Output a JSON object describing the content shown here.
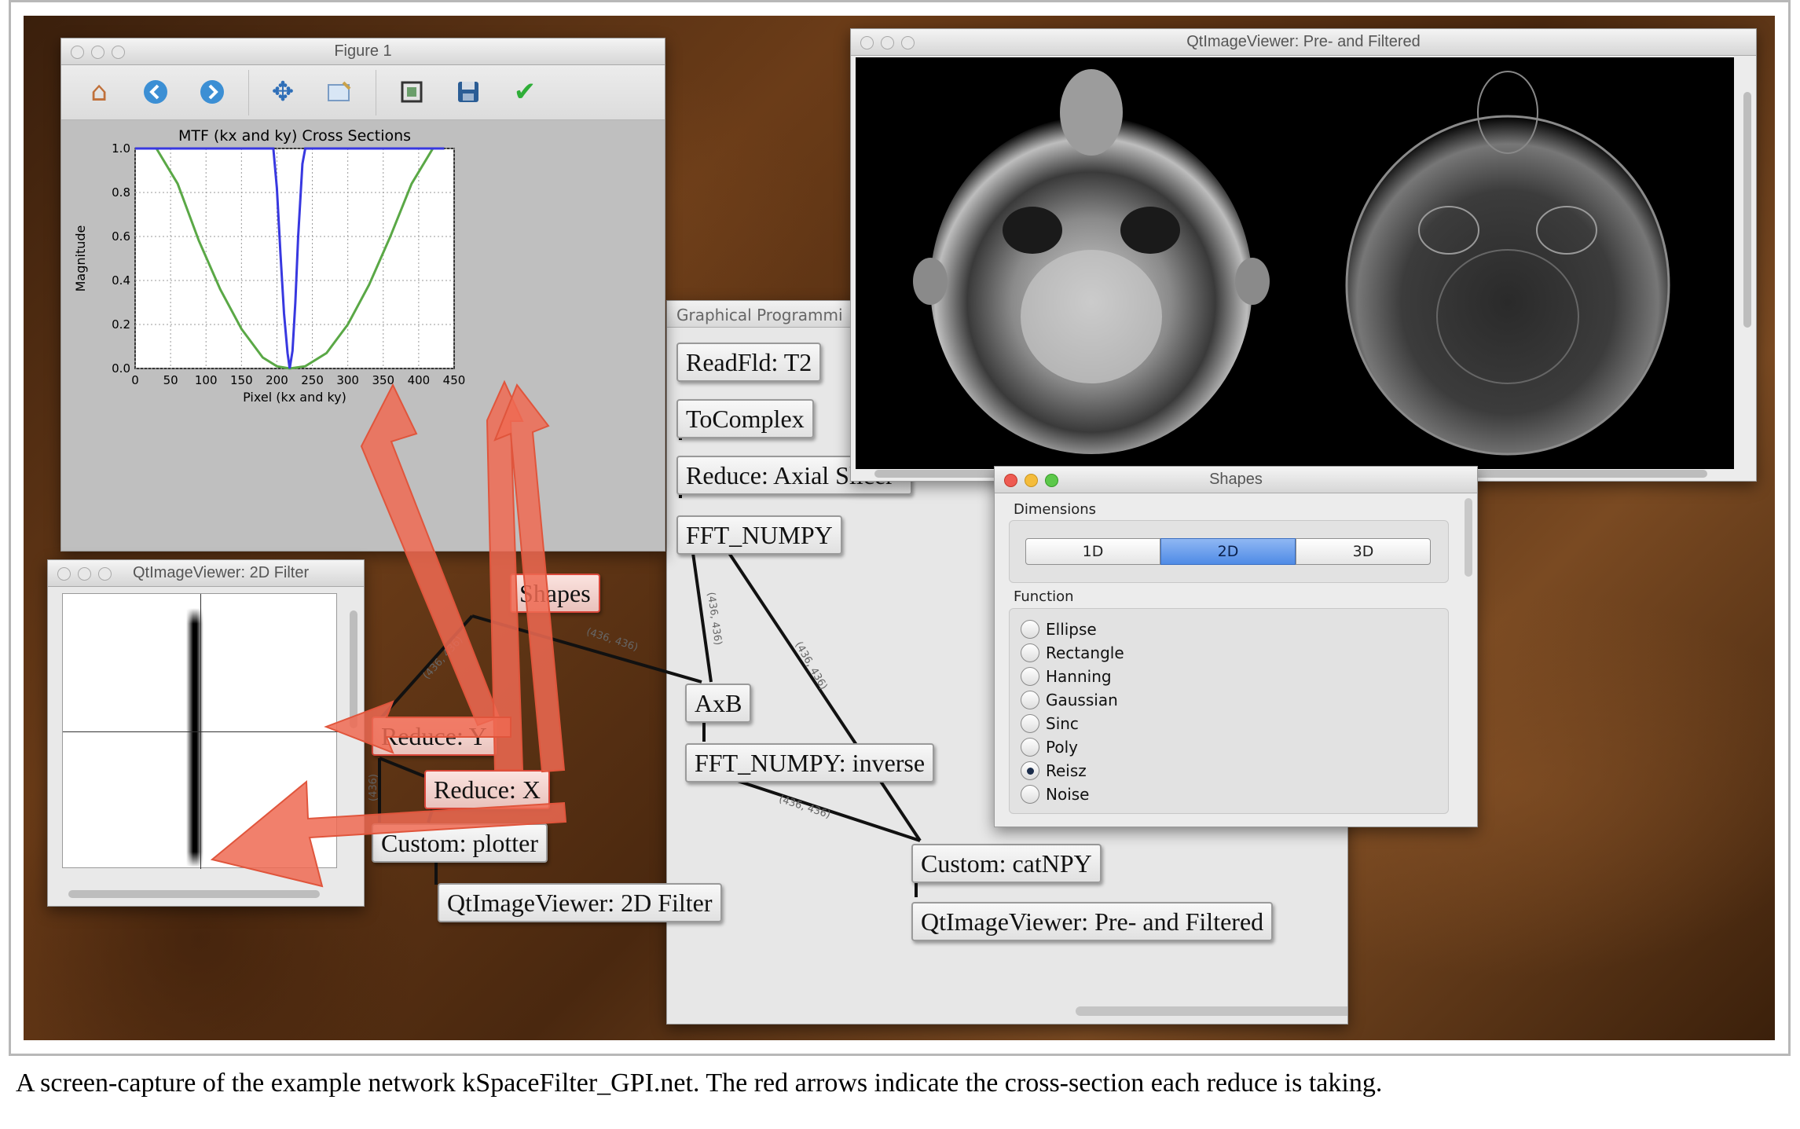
{
  "figure_window": {
    "title": "Figure 1",
    "toolbar": [
      "home-icon",
      "back-icon",
      "forward-icon",
      "pan-icon",
      "zoom-icon",
      "subplots-icon",
      "save-icon",
      "check-icon"
    ]
  },
  "filter_viewer": {
    "title": "QtImageViewer: 2D Filter"
  },
  "preview_viewer": {
    "title": "QtImageViewer: Pre- and Filtered"
  },
  "network_window": {
    "title": "Graphical Programmi"
  },
  "shapes_dialog": {
    "title": "Shapes",
    "dimensions_label": "Dimensions",
    "dimensions": [
      "1D",
      "2D",
      "3D"
    ],
    "selected_dimension": "2D",
    "function_label": "Function",
    "functions": [
      "Ellipse",
      "Rectangle",
      "Hanning",
      "Gaussian",
      "Sinc",
      "Poly",
      "Reisz",
      "Noise"
    ],
    "selected_function": "Reisz"
  },
  "nodes": {
    "readfld": "ReadFld: T2",
    "tocomplex": "ToComplex",
    "reduce_axial": "Reduce: Axial Slicer",
    "fft": "FFT_NUMPY",
    "shapes": "Shapes",
    "axb": "AxB",
    "fft_inverse": "FFT_NUMPY: inverse",
    "reduce_y": "Reduce: Y",
    "reduce_x": "Reduce: X",
    "plotter": "Custom: plotter",
    "viewer_2d": "QtImageViewer: 2D Filter",
    "catnpy": "Custom: catNPY",
    "viewer_pre": "QtImageViewer: Pre- and Filtered"
  },
  "edge_labels": {
    "shapes_axb": "(436, 436)",
    "shapes_reduce": "(436, 436)",
    "fft_axb": "(436, 436)",
    "fft_catnpy": "(436, 436)",
    "inverse_catnpy": "(436, 436)",
    "reduce_plotter": "(436)"
  },
  "chart_data": {
    "type": "line",
    "title": "MTF (kx and ky) Cross Sections",
    "xlabel": "Pixel (kx and ky)",
    "ylabel": "Magnitude",
    "xlim": [
      0,
      450
    ],
    "ylim": [
      0.0,
      1.0
    ],
    "xticks": [
      "0",
      "50",
      "100",
      "150",
      "200",
      "250",
      "300",
      "350",
      "400",
      "450"
    ],
    "yticks": [
      "0.0",
      "0.2",
      "0.4",
      "0.6",
      "0.8",
      "1.0"
    ],
    "grid": true,
    "series": [
      {
        "color": "#5aa846",
        "x": [
          0,
          30,
          60,
          90,
          120,
          150,
          180,
          200,
          218,
          240,
          270,
          300,
          330,
          360,
          390,
          420,
          436
        ],
        "y": [
          1.0,
          1.0,
          0.84,
          0.58,
          0.36,
          0.18,
          0.05,
          0.01,
          0.0,
          0.01,
          0.07,
          0.2,
          0.38,
          0.6,
          0.84,
          1.0,
          1.0
        ]
      },
      {
        "color": "#3838e0",
        "x": [
          0,
          195,
          200,
          205,
          210,
          215,
          218,
          222,
          226,
          230,
          236,
          240,
          436
        ],
        "y": [
          1.0,
          1.0,
          0.82,
          0.52,
          0.25,
          0.07,
          0.0,
          0.08,
          0.3,
          0.6,
          0.93,
          1.0,
          1.0
        ]
      }
    ]
  },
  "caption": "A screen-capture of the example network kSpaceFilter_GPI.net.  The red arrows indicate the cross-section each reduce is taking."
}
